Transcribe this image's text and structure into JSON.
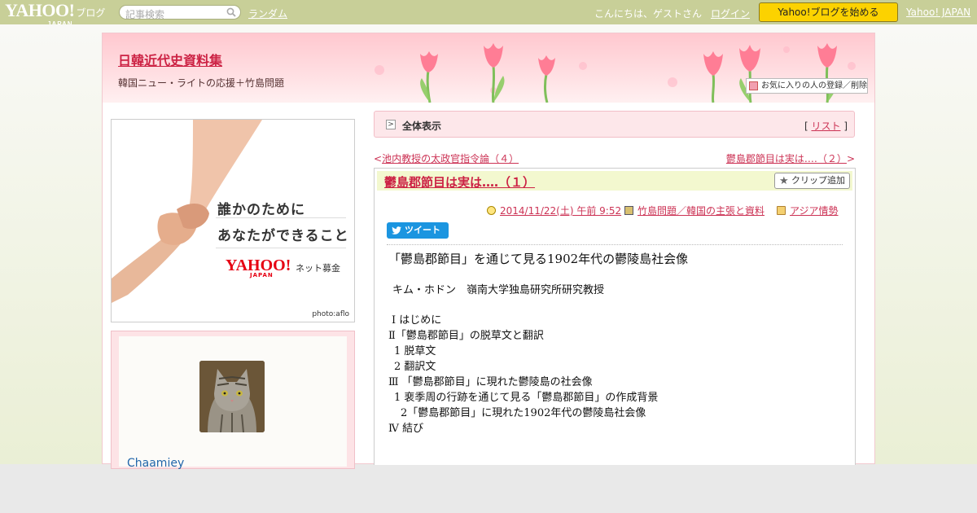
{
  "topbar": {
    "logo_text": "YAHOO!",
    "logo_sub": "ブログ",
    "logo_region": "JAPAN",
    "search_placeholder": "記事検索",
    "random_link": "ランダム",
    "greeting": "こんにちは、ゲストさん",
    "login_link": "ログイン",
    "start_button": "Yahoo!ブログを始める",
    "yahoo_japan_link": "Yahoo! JAPAN"
  },
  "header": {
    "blog_title": "日韓近代史資料集",
    "blog_description": "韓国ニュー・ライトの応援＋竹島問題",
    "favorite_button": "お気に入りの人の登録／削除"
  },
  "sidebar": {
    "banner": {
      "line1": "誰かのために",
      "line2": "あなたができること",
      "brand": "YAHOO!",
      "brand_region": "JAPAN",
      "brand_service": "ネット募金",
      "photo_credit": "photo:aflo"
    },
    "profile": {
      "name": "Chaamiey"
    }
  },
  "main": {
    "all_view_label": "全体表示",
    "list_bracket_open": "[",
    "list_link": "リスト",
    "list_bracket_close": "]",
    "prev_link": "池内教授の太政官指令論（４）",
    "next_link": "鬱島郡節目は実は‥‥（２）",
    "post": {
      "title": "鬱島郡節目は実は‥‥（１）",
      "clip_button": "クリップ追加",
      "datetime": "2014/11/22(土) 午前 9:52",
      "category": "竹島問題／韓国の主張と資料",
      "tag": "アジア情勢",
      "tweet_button": "ツイート",
      "body": {
        "heading": "「鬱島郡節目」を通じて見る1902年代の鬱陵島社会像",
        "author": "キム・ホドン　嶺南大学独島研究所研究教授",
        "toc": [
          "Ⅰ はじめに",
          "Ⅱ「鬱島郡節目」の脱草文と翻訳",
          "  1  脱草文",
          "  2  翻訳文",
          "Ⅲ 「鬱島郡節目」に現れた鬱陵島の社会像",
          "  1  裵季周の行跡を通じて見る「鬱島郡節目」の作成背景",
          "    2「鬱島郡節目」に現れた1902年代の鬱陵島社会像",
          "Ⅳ 結び"
        ]
      }
    }
  },
  "colors": {
    "topbar": "#c8cf98",
    "accent_link": "#cc3355",
    "start_button": "#fcd200",
    "tweet_button": "#1b95e0"
  }
}
